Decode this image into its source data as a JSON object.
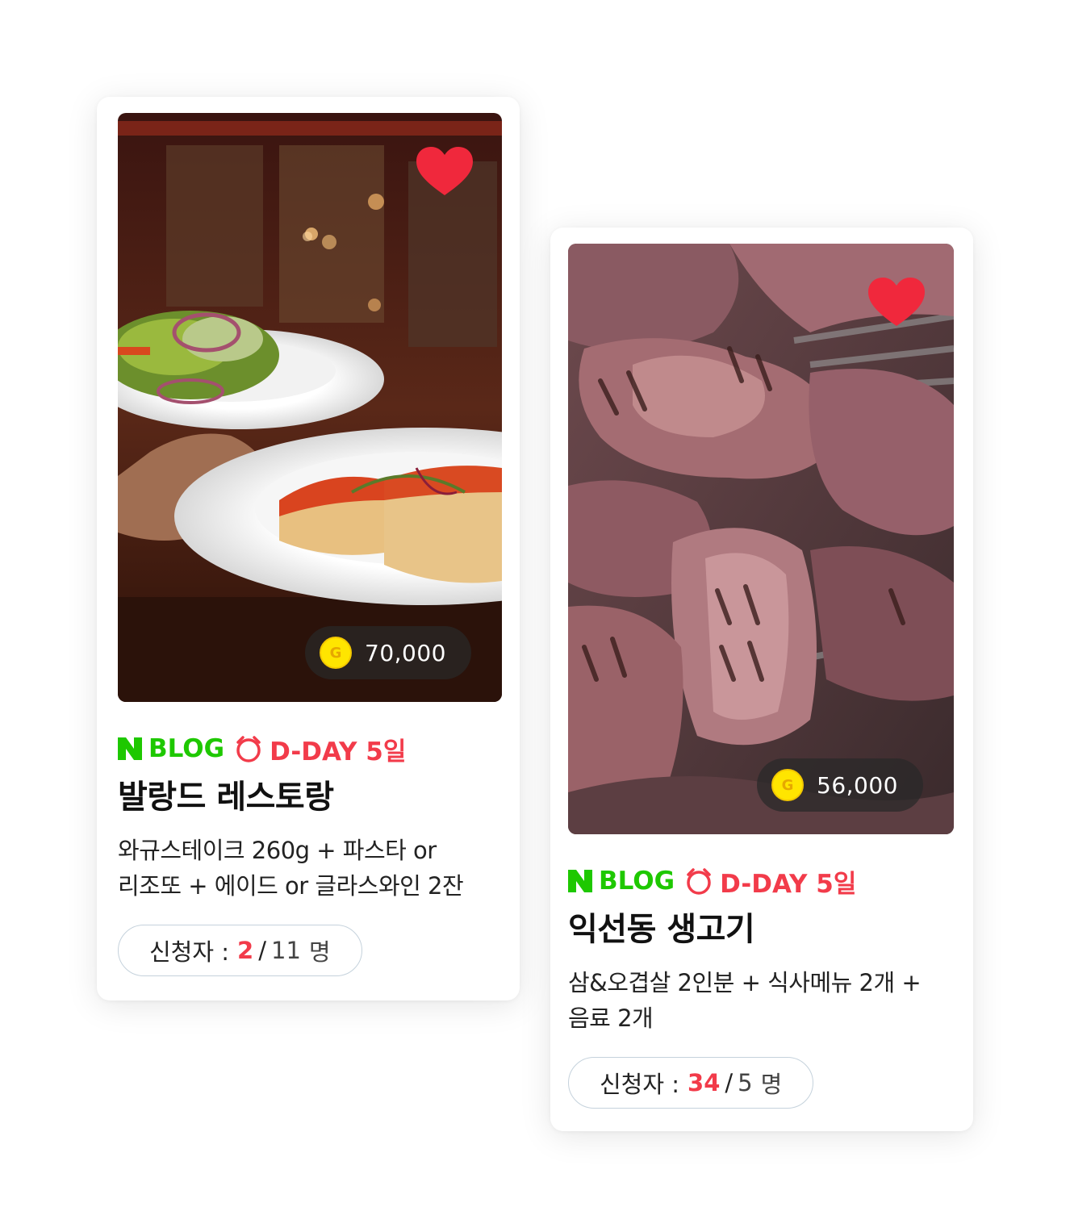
{
  "cards": [
    {
      "reward": "70,000",
      "reward_coin_letter": "G",
      "platform": "BLOG",
      "dday": "D-DAY 5일",
      "title": "발랑드 레스토랑",
      "desc_line1": "와규스테이크 260g + 파스타 or",
      "desc_line2": "리조또 + 에이드 or 글라스와인 2잔",
      "applicants_label": "신청자 :",
      "applicants_count": "2",
      "applicants_slash": "/",
      "applicants_total": "11",
      "applicants_unit": "명",
      "photo_icon": "restaurant-plates-photo"
    },
    {
      "reward": "56,000",
      "reward_coin_letter": "G",
      "platform": "BLOG",
      "dday": "D-DAY 5일",
      "title": "익선동 생고기",
      "desc_line1": "삼&오겹살 2인분 + 식사메뉴 2개 +",
      "desc_line2": "음료 2개",
      "applicants_label": "신청자 :",
      "applicants_count": "34",
      "applicants_slash": "/",
      "applicants_total": "5",
      "applicants_unit": "명",
      "photo_icon": "grilled-pork-photo"
    }
  ],
  "colors": {
    "naver_green": "#1ec800",
    "dday_red": "#f23b4a",
    "heart_red": "#f0283c",
    "coin_yellow": "#ffe500"
  }
}
